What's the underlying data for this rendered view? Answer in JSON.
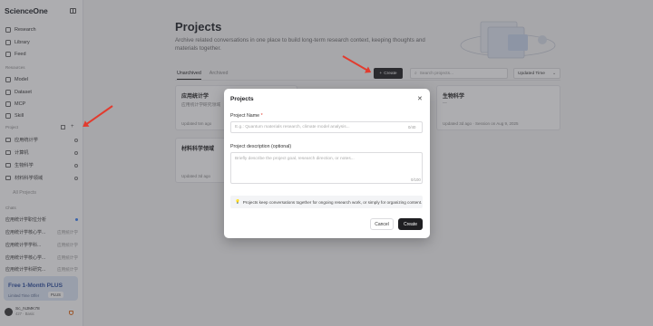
{
  "sidebar": {
    "brand": "ScienceOne",
    "nav": [
      {
        "label": "Research",
        "icon": "research-icon"
      },
      {
        "label": "Library",
        "icon": "library-icon"
      },
      {
        "label": "Feed",
        "icon": "feed-icon"
      }
    ],
    "resources_label": "Resources",
    "resources": [
      {
        "label": "Model",
        "icon": "model-icon"
      },
      {
        "label": "Dataset",
        "icon": "dataset-icon"
      },
      {
        "label": "MCP",
        "icon": "mcp-icon"
      },
      {
        "label": "Skill",
        "icon": "skill-icon"
      }
    ],
    "projects_label": "Project",
    "projects": [
      "应用统计学",
      "计算机",
      "生物科学",
      "材料科学领域"
    ],
    "all_projects": "All Projects",
    "chats_label": "Chats",
    "chats": [
      {
        "label": "应用统计学职位分析",
        "tag": ""
      },
      {
        "label": "应用统计学核心学...",
        "tag": "应用统计学"
      },
      {
        "label": "应用统计学学科...",
        "tag": "应用统计学"
      },
      {
        "label": "应用统计学核心学...",
        "tag": "应用统计学"
      },
      {
        "label": "应用统计学科研究...",
        "tag": "应用统计学"
      }
    ],
    "promo": {
      "title": "Free 1-Month PLUS",
      "subtitle": "Limited Time Offer",
      "badge": "PLUS"
    },
    "user": {
      "name": "Sc_NJMK78",
      "plan": "427 · Basic"
    }
  },
  "main": {
    "title": "Projects",
    "subtitle": "Archive related conversations in one place to build long-term research context, keeping thoughts and materials together.",
    "tabs": [
      "Unarchived",
      "Archived"
    ],
    "create_label": "Create",
    "search_placeholder": "Search projects...",
    "sort_label": "Updated Time",
    "cards": [
      {
        "title": "应用统计学",
        "desc": "应用统计学研究领域",
        "meta": "Updated 5m ago"
      },
      {
        "title": "生物科学",
        "desc": "—",
        "meta": "Updated 3d ago · Session on Aug 9, 2025"
      },
      {
        "title": "材料科学领域",
        "desc": "",
        "meta": "Updated 3d ago"
      }
    ]
  },
  "modal": {
    "title": "Projects",
    "name_label": "Project Name",
    "name_placeholder": "E.g.: Quantum materials research, climate model analysis...",
    "name_count": "0/40",
    "desc_label": "Project description (optional)",
    "desc_placeholder": "Briefly describe the project goal, research direction, or notes...",
    "desc_count": "0/100",
    "info": "Projects keep conversations together for ongoing research work, or simply for organizing content.",
    "cancel": "Cancel",
    "create": "Create"
  },
  "colors": {
    "accent": "#1f1f22",
    "arrow": "#e23b2e",
    "promo_bg": "#dde7f7"
  }
}
